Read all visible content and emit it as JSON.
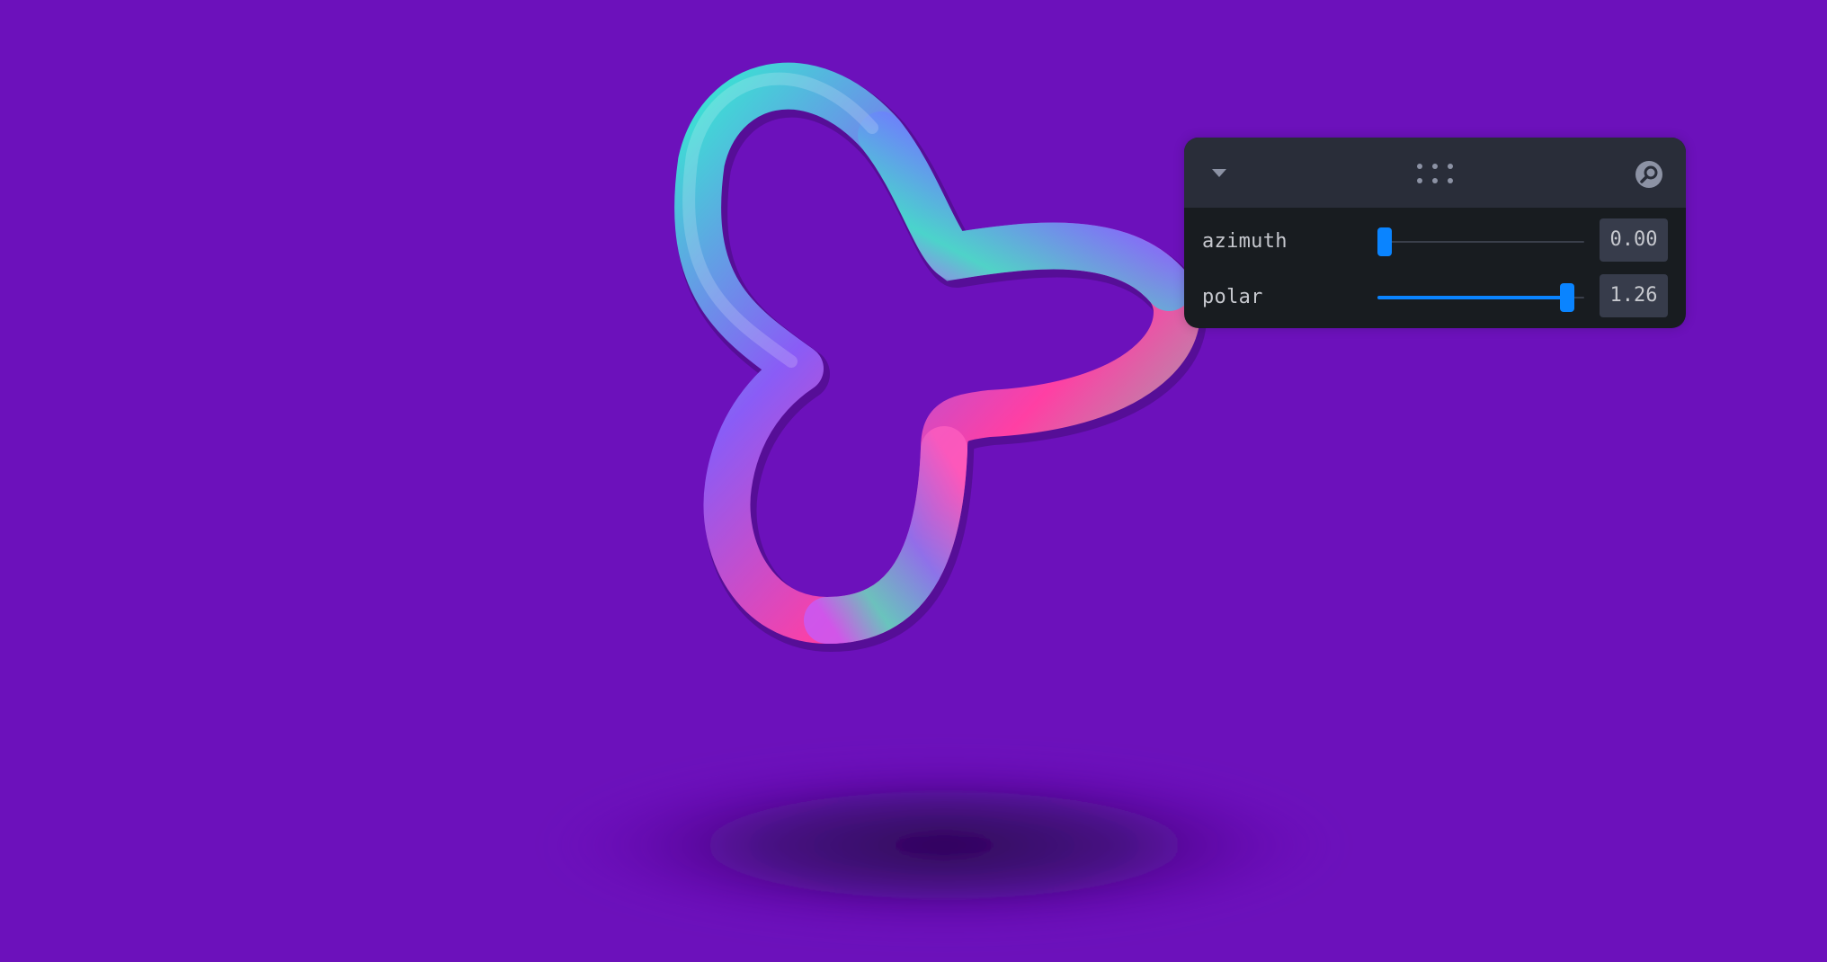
{
  "scene": {
    "background_color": "#6c11bb",
    "object": "trefoil-knot",
    "object_colors": [
      "#38e6d2",
      "#8a5cf6",
      "#ff3fa4",
      "#5fe3b0"
    ]
  },
  "panel": {
    "collapse_icon": "chevron-down-icon",
    "drag_icon": "drag-handle-icon",
    "search_icon": "search-icon",
    "accent_color": "#0a84ff",
    "controls": [
      {
        "label": "azimuth",
        "value": "0.00",
        "fraction": 0.0
      },
      {
        "label": "polar",
        "value": "1.26",
        "fraction": 0.95
      }
    ]
  }
}
